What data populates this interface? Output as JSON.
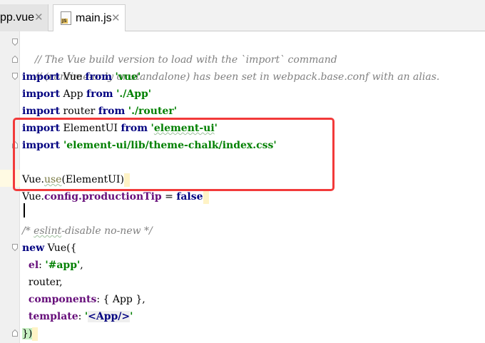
{
  "tabs": [
    {
      "label": "pp.vue",
      "active": false,
      "icon": "vue-file-icon"
    },
    {
      "label": "main.js",
      "active": true,
      "icon": "js-file-icon",
      "icon_badge": "JS"
    }
  ],
  "code": {
    "line1": "// The Vue build version to load with the `import` command",
    "line2": "// (runtime-only or standalone) has been set in webpack.base.conf with an alias.",
    "kw_import": "import",
    "kw_from": "from",
    "kw_new": "new",
    "vue_ident": " Vue ",
    "vue_str": "'vue'",
    "app_ident": " App ",
    "app_str": "'./App'",
    "router_ident": " router ",
    "router_str": "'./router'",
    "elementui_ident": " ElementUI ",
    "elementui_str_open": "'",
    "elementui_str_word": "element-ui",
    "elementui_str_close": "'",
    "css_str": " 'element-ui/lib/theme-chalk/index.css'",
    "vue_use_obj": "Vue.",
    "vue_use_method": "use",
    "vue_use_arg": "(ElementUI)",
    "config_obj": "Vue.",
    "config_prop": "config.productionTip",
    "config_eq": " = ",
    "config_val": "false",
    "eslint_open": "/* ",
    "eslint_word": "eslint",
    "eslint_rest": "-disable no-new */",
    "new_rest": " Vue({",
    "el_key": "el",
    "el_colon": ": ",
    "el_val": "'#app'",
    "el_comma": ",",
    "router_line": "router,",
    "components_key": "components",
    "components_rest": ": { App },",
    "template_key": "template",
    "template_colon": ": ",
    "template_q1": "'",
    "template_tag": "<App/>",
    "template_q2": "'",
    "close_line": "})"
  },
  "colors": {
    "keyword": "#000080",
    "string": "#008000",
    "comment": "#808080",
    "property": "#660e7a",
    "highlight_box": "#f23a3a",
    "current_line": "#fffae3"
  }
}
